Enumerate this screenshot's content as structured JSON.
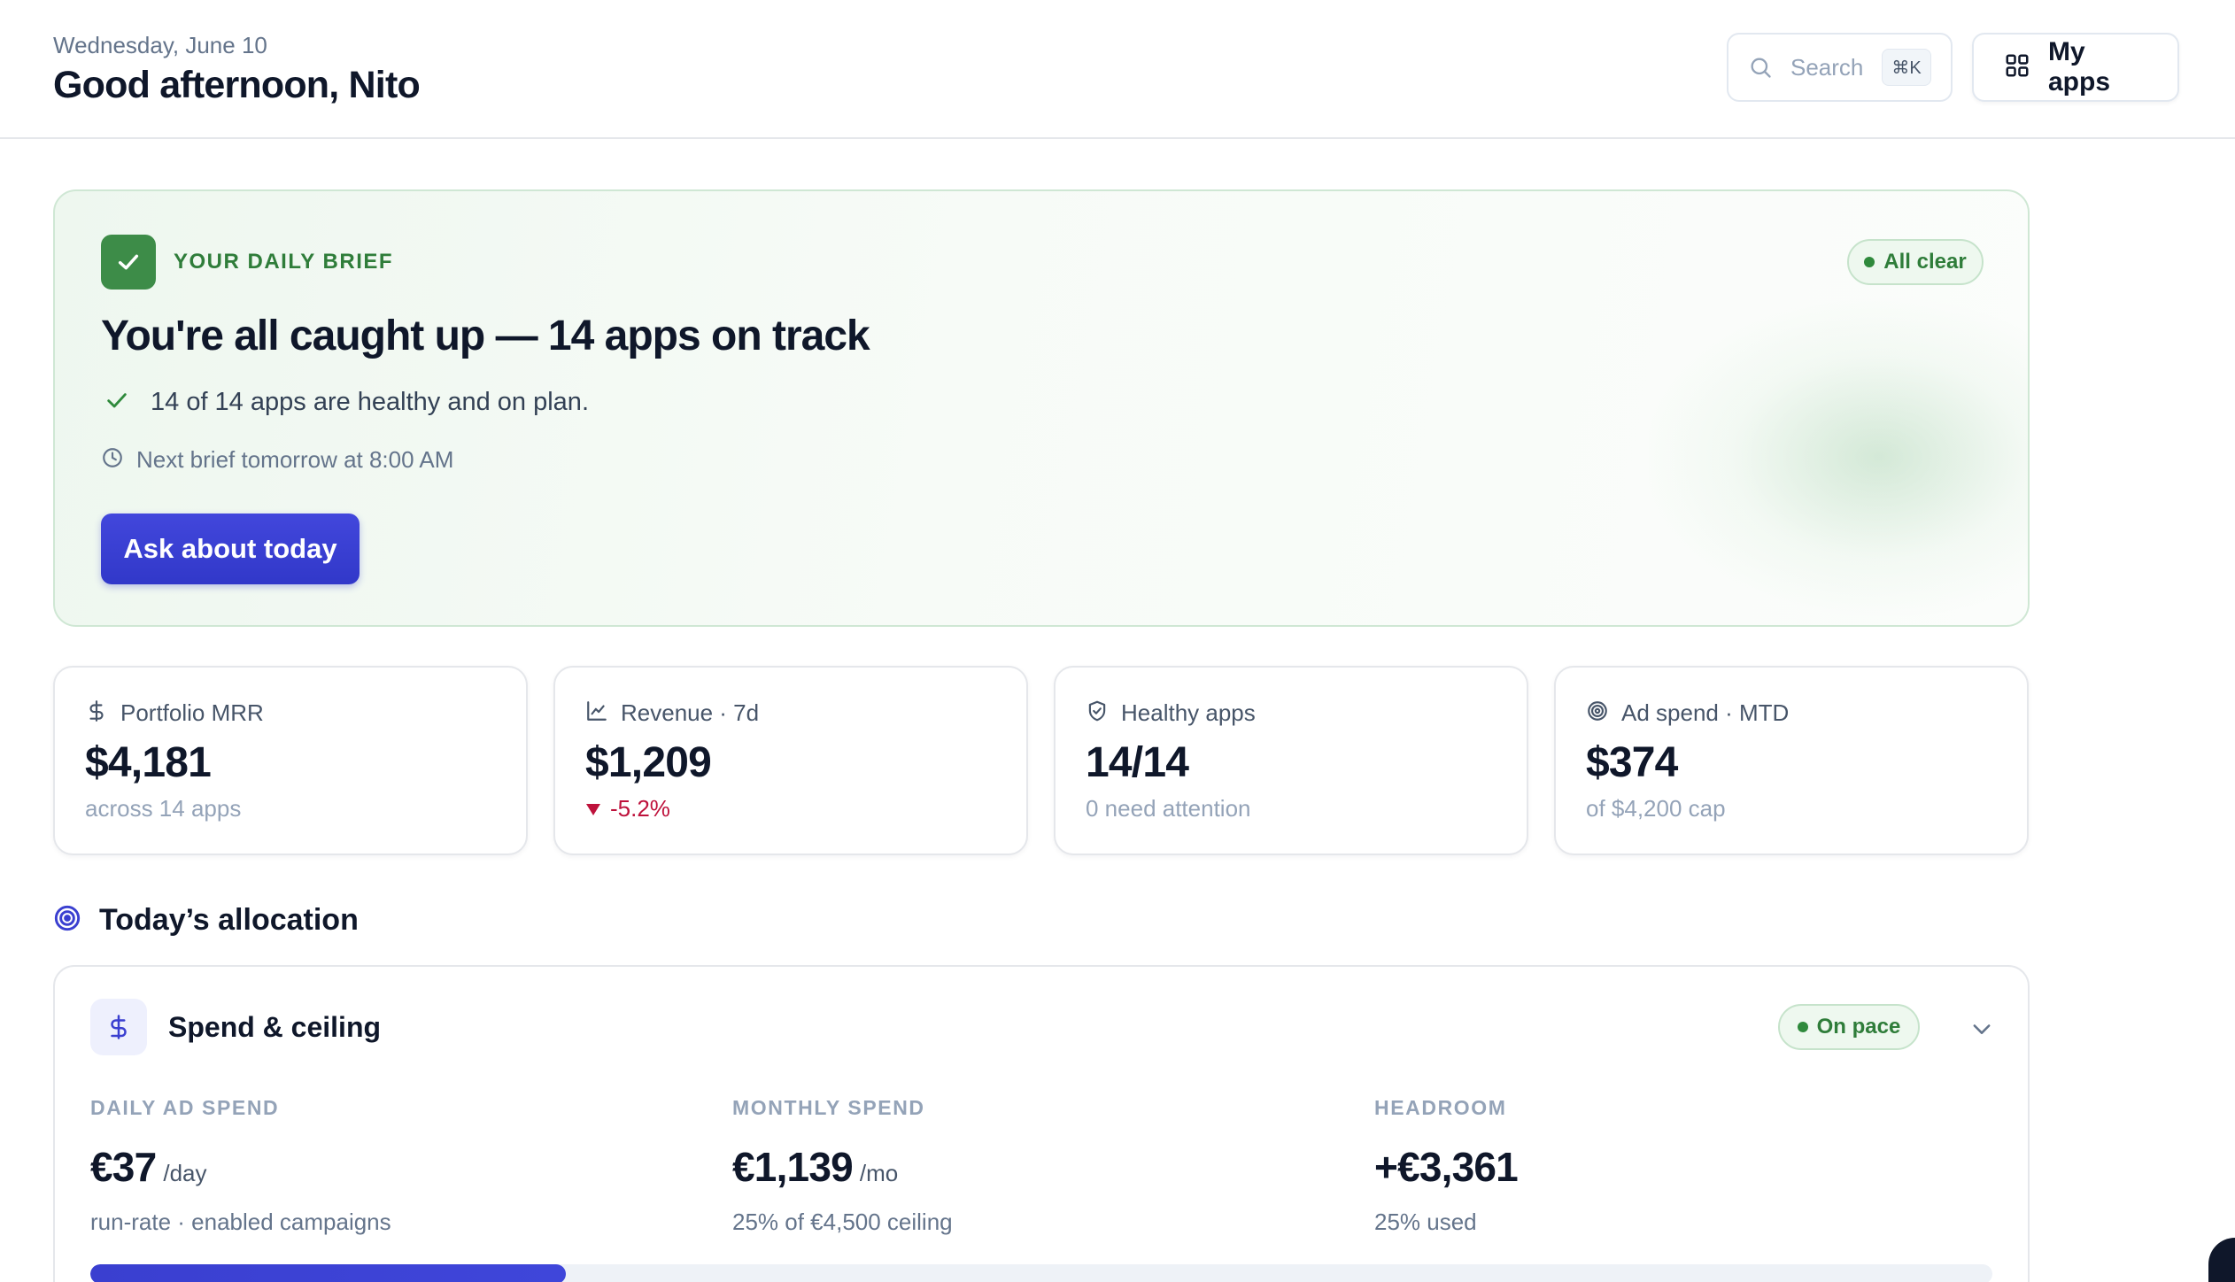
{
  "header": {
    "date": "Wednesday, June 10",
    "greeting": "Good afternoon, Nito",
    "search": {
      "placeholder": "Search",
      "shortcut": "⌘K",
      "icon": "search-icon"
    },
    "my_apps": {
      "label": "My apps",
      "icon": "grid-icon"
    }
  },
  "brief": {
    "kicker": "YOUR DAILY BRIEF",
    "status": "All clear",
    "title": "You're all caught up — 14 apps on track",
    "line": "14 of 14 apps are healthy and on plan.",
    "next": "Next brief tomorrow at 8:00 AM",
    "button": "Ask about today"
  },
  "stats": [
    {
      "icon": "dollar-icon",
      "label": "Portfolio MRR",
      "value": "$4,181",
      "sub": "across 14 apps"
    },
    {
      "icon": "line-chart-icon",
      "label": "Revenue · 7d",
      "value": "$1,209",
      "change": "-5.2%",
      "change_direction": "down"
    },
    {
      "icon": "shield-icon",
      "label": "Healthy apps",
      "value": "14/14",
      "sub": "0 need attention"
    },
    {
      "icon": "target-icon",
      "label": "Ad spend · MTD",
      "value": "$374",
      "sub": "of $4,200 cap"
    }
  ],
  "allocation": {
    "title": "Today’s allocation",
    "card": {
      "title": "Spend & ceiling",
      "status": "On pace",
      "columns": [
        {
          "label": "DAILY AD SPEND",
          "value": "€37",
          "unit": "/day",
          "desc": "run-rate · enabled campaigns"
        },
        {
          "label": "MONTHLY SPEND",
          "value": "€1,139",
          "unit": "/mo",
          "desc": "25% of €4,500 ceiling"
        },
        {
          "label": "HEADROOM",
          "value": "+€3,361",
          "unit": "",
          "desc": "25% used"
        }
      ],
      "progress_percent": 25
    }
  },
  "colors": {
    "accent": "#3a3fd0",
    "success": "#2f7d3a",
    "danger": "#be123c",
    "brief_background": "#eef7ef"
  }
}
